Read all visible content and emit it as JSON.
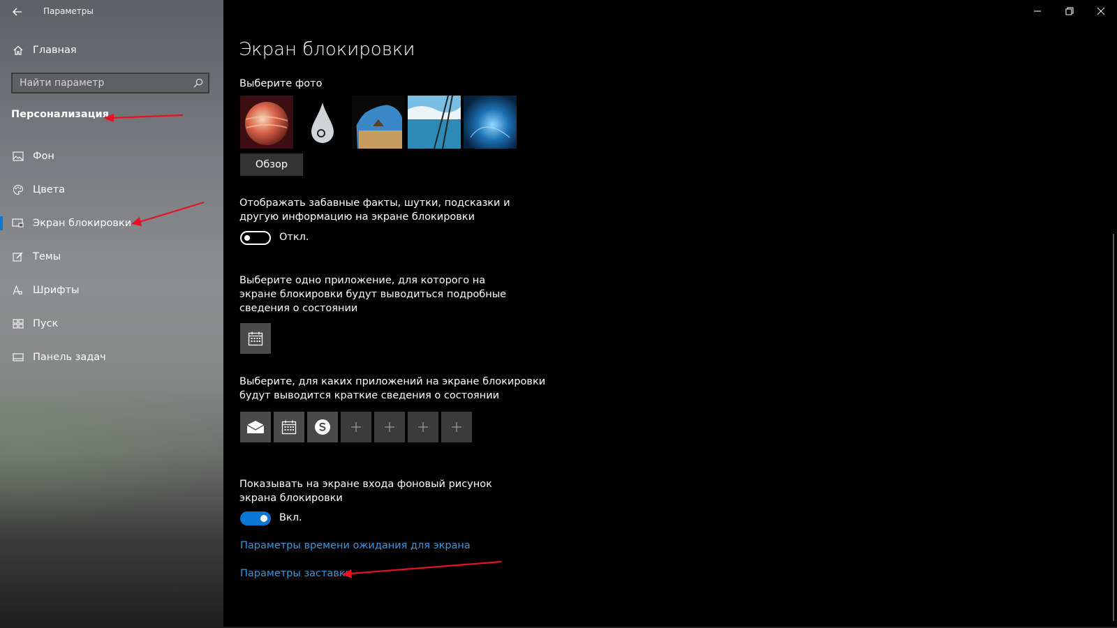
{
  "window": {
    "title": "Параметры"
  },
  "sidebar": {
    "home_label": "Главная",
    "search_placeholder": "Найти параметр",
    "section_title": "Персонализация",
    "items": [
      {
        "label": "Фон",
        "icon": "image-icon"
      },
      {
        "label": "Цвета",
        "icon": "palette-icon"
      },
      {
        "label": "Экран блокировки",
        "icon": "lock-screen-icon",
        "selected": true
      },
      {
        "label": "Темы",
        "icon": "brush-icon"
      },
      {
        "label": "Шрифты",
        "icon": "font-icon"
      },
      {
        "label": "Пуск",
        "icon": "start-icon"
      },
      {
        "label": "Панель задач",
        "icon": "taskbar-icon"
      }
    ]
  },
  "main": {
    "title": "Экран блокировки",
    "photo_label": "Выберите фото",
    "browse_label": "Обзор",
    "fun_facts": {
      "text": "Отображать забавные факты, шутки, подсказки и другую информацию на экране блокировки",
      "state": "Откл.",
      "on": false
    },
    "detailed_app": {
      "text": "Выберите одно приложение, для которого на экране блокировки будут выводиться подробные сведения о состоянии",
      "icon": "calendar-icon"
    },
    "quick_apps": {
      "text": "Выберите, для каких приложений на экране блокировки будут выводится краткие сведения о состоянии",
      "tiles": [
        "mail-icon",
        "calendar-icon",
        "skype-icon",
        "plus-icon",
        "plus-icon",
        "plus-icon",
        "plus-icon"
      ]
    },
    "signin_background": {
      "text": "Показывать на экране входа фоновый рисунок экрана блокировки",
      "state": "Вкл.",
      "on": true
    },
    "timeout_link": "Параметры времени ожидания для экрана",
    "screensaver_link": "Параметры заставки"
  },
  "colors": {
    "accent": "#0a78d4",
    "link": "#3a96dd",
    "annotation_arrow": "#e81123"
  }
}
